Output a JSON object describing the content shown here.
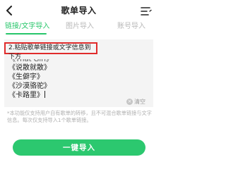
{
  "header": {
    "title": "歌单导入",
    "back_icon": "chevron-left-icon",
    "menu_icon": "menu-lines-icon"
  },
  "tabs": [
    {
      "label": "链接/文字导入",
      "active": true
    },
    {
      "label": "图片导入",
      "active": false
    },
    {
      "label": "账号导入",
      "active": false
    }
  ],
  "input": {
    "instruction": "2.粘贴歌单链接或文字信息到下方",
    "lines": [
      "《That Girl》",
      "《说散就散》",
      "《生僻字》",
      "《沙漠骆驼》",
      "《卡路里》"
    ],
    "clear_label": "清空"
  },
  "note": "*本功能仅支持用户自有歌单的转移，且不可混合歌单链接与文字信息。每次仅支持导入1个歌单链接。",
  "import_button": "一键导入",
  "colors": {
    "accent": "#2cc86f",
    "highlight_border": "#e02b2b"
  }
}
